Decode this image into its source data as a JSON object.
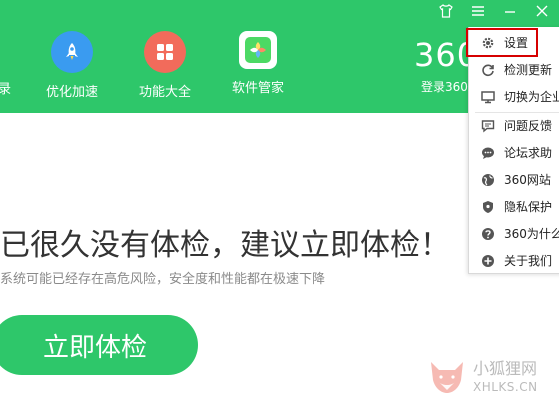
{
  "header": {
    "partial_tab_label": "录",
    "nav_items": [
      {
        "label": "优化加速",
        "icon": "rocket-icon",
        "color": "#3a9bf0"
      },
      {
        "label": "功能大全",
        "icon": "grid-icon",
        "color": "#f26b5b"
      },
      {
        "label": "软件管家",
        "icon": "software-manager-icon",
        "color": "#4cd964"
      }
    ],
    "logo_text": "360",
    "login_text": "登录360"
  },
  "window_controls": [
    "shirt-icon",
    "menu-icon",
    "minimize-icon",
    "close-icon"
  ],
  "menu": {
    "items": [
      {
        "label": "设置",
        "icon": "gear-icon"
      },
      {
        "label": "检测更新",
        "icon": "refresh-icon"
      },
      {
        "label": "切换为企业",
        "icon": "monitor-icon"
      },
      {
        "label": "问题反馈",
        "icon": "feedback-icon"
      },
      {
        "label": "论坛求助",
        "icon": "chat-bubble-icon"
      },
      {
        "label": "360网站",
        "icon": "globe-icon"
      },
      {
        "label": "隐私保护",
        "icon": "shield-icon"
      },
      {
        "label": "360为什么",
        "icon": "question-icon"
      },
      {
        "label": "关于我们",
        "icon": "plus-circle-icon"
      }
    ],
    "highlight_color": "#d60000"
  },
  "main": {
    "headline": "已很久没有体检，建议立即体检！",
    "subtext": "系统可能已经存在高危风险，安全度和性能都在极速下降",
    "check_button": "立即体检"
  },
  "watermark": {
    "text_cn": "小狐狸网",
    "text_en": "XHLKS.CN"
  },
  "colors": {
    "brand_green": "#2ec76a",
    "headline": "#333333",
    "subtext": "#8a8a8a"
  }
}
